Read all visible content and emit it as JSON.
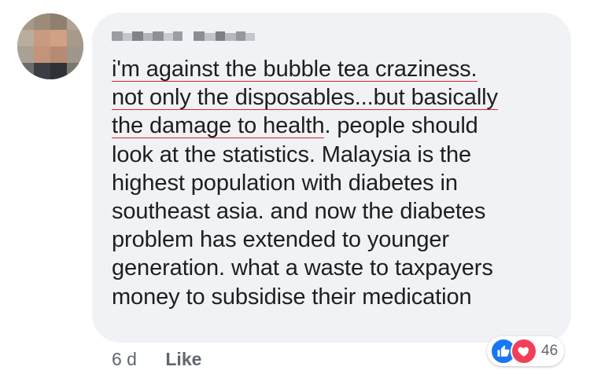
{
  "comment": {
    "lines": [
      {
        "text": "i'm against the bubble tea craziness."
      },
      {
        "text": "not only the disposables...but basically"
      },
      {
        "underlined": "the damage to health",
        "rest": ". people should"
      },
      {
        "text": "look at the statistics. Malaysia is the"
      },
      {
        "text": "highest population with diabetes in"
      },
      {
        "text": "southeast asia. and now the diabetes"
      },
      {
        "text": "problem has extended to younger"
      },
      {
        "text": "generation. what a waste to taxpayers"
      },
      {
        "text": "money to subsidise their medication"
      }
    ]
  },
  "footer": {
    "timestamp": "6 d",
    "like_label": "Like"
  },
  "reactions": {
    "icons": [
      "like-thumb-icon",
      "love-heart-icon"
    ],
    "count": "46"
  },
  "colors": {
    "bubble": "#f0f2f5",
    "text": "#1c1e21",
    "underline": "#e0202c",
    "like_blue": "#1877f2",
    "love_red": "#f33e58"
  }
}
